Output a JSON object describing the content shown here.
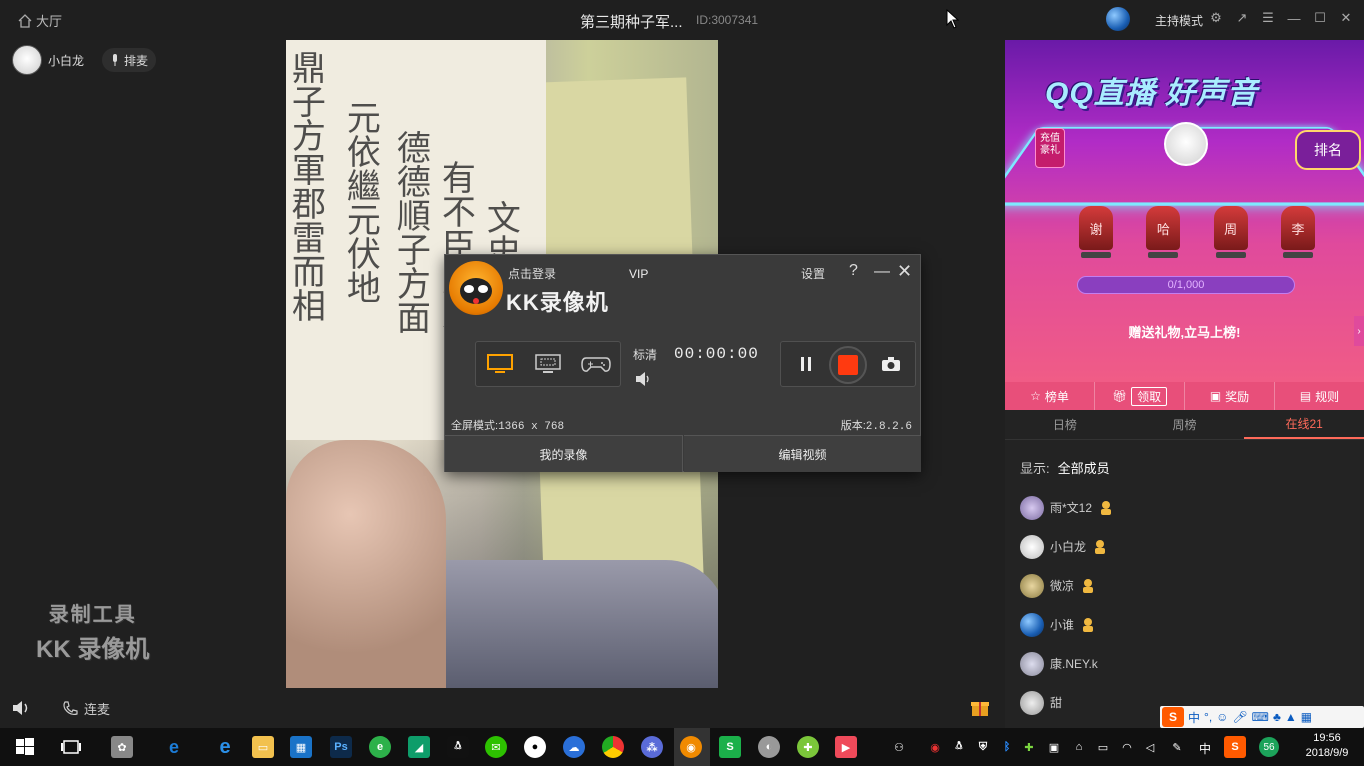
{
  "topbar": {
    "hall_label": "大厅",
    "room_title": "第三期种子军...",
    "room_id": "ID:3007341",
    "host_mode": "主持模式"
  },
  "left": {
    "user_name": "小白龙",
    "queue_label": "排麦",
    "watermark_line1": "录制工具",
    "watermark_line2": "KK 录像机",
    "mic_link_label": "连麦"
  },
  "recorder": {
    "login": "点击登录",
    "vip": "VIP",
    "title": "KK录像机",
    "settings": "设置",
    "help": "?",
    "quality": "标清",
    "timer": "00:00:00",
    "fullscreen_label": "全屏模式:",
    "fullscreen_value": "1366 x 768",
    "version_label": "版本:",
    "version_value": "2.8.2.6",
    "my_videos": "我的录像",
    "edit_video": "编辑视频"
  },
  "right": {
    "banner_title": "QQ直播 好声音",
    "recharge": "充值豪礼",
    "signup": "排名",
    "seats": [
      "谢",
      "哈",
      "周",
      "李"
    ],
    "progress_text": "0/1,000",
    "slogan": "赠送礼物,立马上榜!",
    "banner_tabs": [
      "榜单",
      "领取",
      "奖励",
      "规则"
    ],
    "list_tabs": [
      "日榜",
      "周榜",
      "在线21"
    ],
    "active_tab": "在线21",
    "filter_label": "显示:",
    "filter_value": "全部成员",
    "members": [
      {
        "name": "雨*文12",
        "badge": true
      },
      {
        "name": "小白龙",
        "badge": true
      },
      {
        "name": "微凉",
        "badge": true
      },
      {
        "name": "小谁",
        "badge": true
      },
      {
        "name": "康.NEY.k",
        "badge": false
      },
      {
        "name": "甜",
        "badge": false
      }
    ]
  },
  "ime": {
    "logo": "S",
    "lang": "中"
  },
  "taskbar": {
    "tray_lang": "中",
    "notification_count": "56",
    "time": "19:56",
    "date": "2018/9/9"
  },
  "colors": {
    "record_red": "#ff3a10",
    "active_tab": "#ff6a5a",
    "banner_pink": "#e84f7a"
  }
}
